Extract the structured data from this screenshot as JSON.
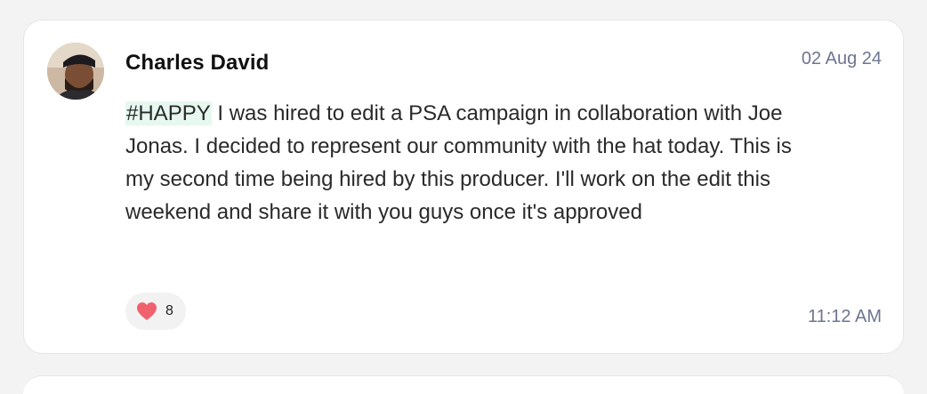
{
  "post": {
    "author": "Charles David",
    "date": "02 Aug 24",
    "hashtag": "#HAPPY",
    "text": " I was hired to edit a PSA campaign in collaboration with Joe Jonas. I decided to represent our community with the hat today. This is my second time being hired by this producer. I'll work on the edit this weekend and share it with you guys once it's approved",
    "reaction": {
      "icon": "heart-icon",
      "count": "8",
      "color": "#f0616d"
    },
    "time": "11:12 AM"
  }
}
